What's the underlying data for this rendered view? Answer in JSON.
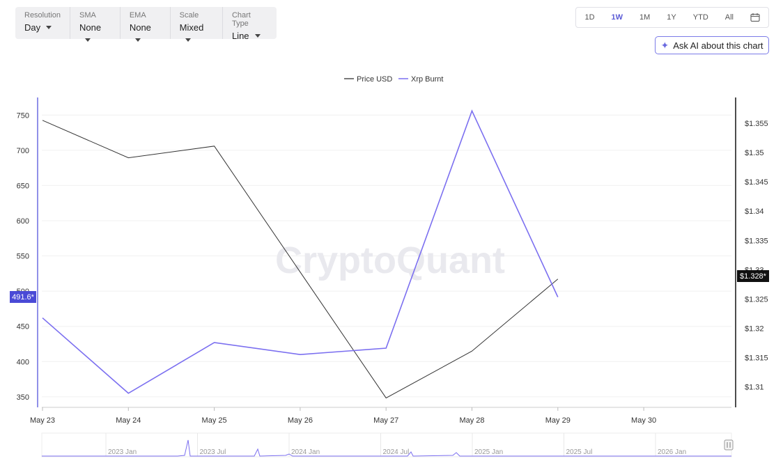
{
  "toolbar": {
    "resolution": {
      "label": "Resolution",
      "value": "Day"
    },
    "sma": {
      "label": "SMA",
      "value": "None"
    },
    "ema": {
      "label": "EMA",
      "value": "None"
    },
    "scale": {
      "label": "Scale",
      "value": "Mixed"
    },
    "chart_type": {
      "label": "Chart Type",
      "value": "Line"
    }
  },
  "range": {
    "options": [
      "1D",
      "1W",
      "1M",
      "1Y",
      "YTD",
      "All"
    ],
    "active": "1W"
  },
  "ai_button": {
    "label": "Ask AI about this chart",
    "icon": "sparkle-icon"
  },
  "watermark": "CryptoQuant",
  "colors": {
    "price": "#333333",
    "burnt": "#7b6ff0",
    "accent": "#5b5bd6"
  },
  "chart_data": {
    "type": "line",
    "legend_position": "top-center",
    "categories": [
      "May 23",
      "May 24",
      "May 25",
      "May 26",
      "May 27",
      "May 28",
      "May 29",
      "May 30"
    ],
    "series": [
      {
        "name": "Price USD",
        "axis": "right",
        "values": [
          1.3555,
          1.3491,
          1.3511,
          1.3296,
          1.3081,
          1.3161,
          1.3284,
          null
        ]
      },
      {
        "name": "Xrp Burnt",
        "axis": "left",
        "values": [
          462,
          355,
          427,
          410,
          419,
          756,
          491.6,
          null
        ]
      }
    ],
    "left_axis": {
      "ticks": [
        350,
        400,
        450,
        500,
        550,
        600,
        650,
        700,
        750
      ],
      "range": [
        335,
        775
      ]
    },
    "right_axis": {
      "ticks": [
        "$1.31",
        "$1.315",
        "$1.32",
        "$1.325",
        "$1.33",
        "$1.335",
        "$1.34",
        "$1.345",
        "$1.35",
        "$1.355"
      ],
      "tick_values": [
        1.31,
        1.315,
        1.32,
        1.325,
        1.33,
        1.335,
        1.34,
        1.345,
        1.35,
        1.355
      ],
      "range": [
        1.3065,
        1.3594
      ]
    },
    "left_badge": "491.6*",
    "right_badge": "$1.328*",
    "grid": true,
    "navigator": {
      "labels": [
        "2023 Jan",
        "2023 Jul",
        "2024 Jan",
        "2024 Jul",
        "2025 Jan",
        "2025 Jul",
        "2026 Jan"
      ]
    }
  }
}
